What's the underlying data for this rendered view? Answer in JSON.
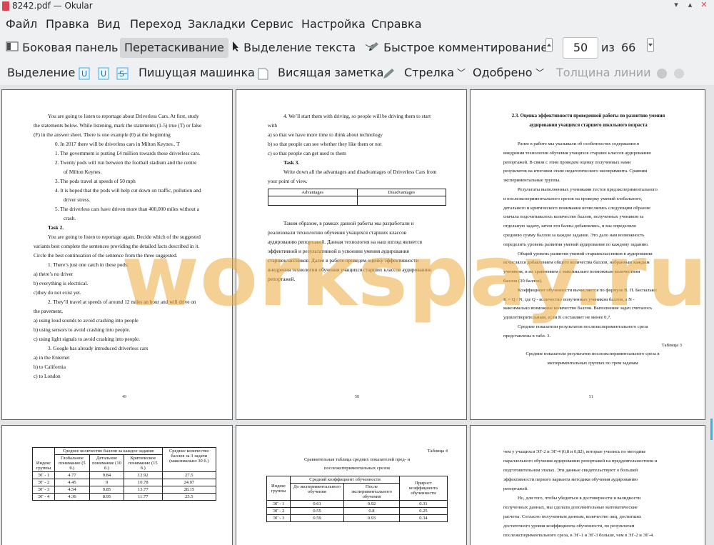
{
  "window": {
    "title": "8242.pdf  — Okular"
  },
  "menu": [
    "Файл",
    "Правка",
    "Вид",
    "Переход",
    "Закладки",
    "Сервис",
    "Настройка",
    "Справка"
  ],
  "toolbar1": {
    "sidebar": "Боковая панель",
    "drag": "Перетаскивание",
    "text_select": "Выделение текста",
    "quick_comment": "Быстрое комментирование",
    "page_current": "50",
    "page_of": "из",
    "page_total": "66"
  },
  "toolbar2": {
    "select": "Выделение",
    "typewriter": "Пишущая машинка",
    "hanging_note": "Висящая заметка",
    "arrow": "Стрелка",
    "approved": "Одобрено",
    "line_width": "Толщина линии"
  },
  "watermark": "workspay.ru",
  "pages": {
    "p49": {
      "lines": [
        "You are going to listen to reportage about Driverless Cars. At first, study",
        "the statements below. While listening, mark the statements (1-5) true (T) or false",
        "(F) in the answer sheet. There is one example (0) at the beginning",
        "0.  In 2017 there will be driverless cars in Milton Keynes.. T",
        "1.  The government is putting £4 million towards these driverless cars.",
        "2.  Twenty pods will run between the football stadium and the centre",
        "of Milton Keynes.",
        "3.  The pods travel at speeds of 50 mph",
        "4.  It is hoped that the pods will help cut down on traffic, pollution and",
        "driver stress.",
        "5.  The driverless cars have driven more than 400,000 miles without a",
        "crash.",
        "Task 2.",
        "You are going to listen to reportage again. Decide which of the suggested",
        "variants best complete the sentences providing the detailed facts described in it.",
        "Circle the best continuation of the sentence from the three suggested.",
        "1. There’s just one catch in these pods:",
        "a) there’s no driver",
        "b) everything is electrical.",
        "c)they do not exist yet.",
        "2. They’ll travel at speeds of around 12 miles an hour and will drive on",
        "the pavement,",
        "a) using loud sounds to avoid crashing into people",
        "b) using sensors to avoid crashing into people.",
        "c) using light signals to avoid crashing into people.",
        "3. Google has already introduced driverless cars",
        "a) in the Enternet",
        "b) to California",
        "c) to London"
      ],
      "num": "49"
    },
    "p50": {
      "lines": [
        "4. We’ll start them with driving, so people will be driving them to start",
        "with",
        "a) so that we have more time to think about technology",
        "b) so that people can see whether they like them or not",
        "c) so that people can get used to them",
        "Task 3.",
        "Write down all the advantages and disadvantages of Driverless Cars from",
        "your point of view."
      ],
      "table_headers": [
        "Advantages",
        "Disadvantages"
      ],
      "para": [
        "Таким образом, в рамках данной работы мы разработали и",
        "реализовали технологию обучения учащихся старших классов",
        "аудированию репортажей. Данная технология на наш взгляд является",
        "эффективной и результативной в усвоении умения аудирования",
        "старшеклассников. Далее в работе проведем оценку эффективности",
        "внедрения технологии обучения учащихся старших классов аудированию",
        "репортажей."
      ],
      "num": "50"
    },
    "p51": {
      "heading1": "2.3. Оценка эффективности проведенной работы по развитию умения",
      "heading2": "аудирования учащихся старшего школьного возраста",
      "lines": [
        "Ранее в работе мы указывали об особенностях содержания в",
        "внедрения технологии обучения учащихся старших классов аудированию",
        "репортажей. В связи с этим проведем оценку полученных нами",
        "результатов на итоговом этапе педагогического эксперимента. Сравним",
        "экспериментальные группы.",
        "Результаты выполненных учениками тестов предэкспериментального",
        "и послеэкспериментального срезов на проверку умений глобального,",
        "детального и критического понимания исчислялись следующим образом:",
        "сначала подсчитывалось количество баллов, полученных учеником за",
        "отдельную задачу, затем эти баллы добавлялись, и мы определяли",
        "среднюю сумму баллов за каждое задание. Это дало нам возможность",
        "определить уровень развития умений аудирования по каждому заданию.",
        "Общий уровень развития умений старшеклассников в аудировании",
        "исчислялся добавлением общего количества баллов, набранным каждым",
        "учеником, и их сравнением с максимально возможным количеством",
        "баллов (30 баллов).",
        "Коэффициент обученности вычисляется по формуле В. П. Беспалько:",
        "K = Q / N, где Q - количество полученных учеником баллов, а N -",
        "максимально возможное количество баллов. Выполнение задач считалось",
        "удовлетворительным, если К составляет не менее 0,7.",
        "Средние показатели результатов послеэкспериментального среза",
        "представлены в табл. 3."
      ],
      "table_label": "Таблица 3",
      "caption1": "Средние показатели результатов послеэкспериментального среза в",
      "caption2": "экспериментальных группах по трем задачам",
      "num": "51"
    },
    "p52": {
      "head_group": "Среднее количество баллов за каждое задание",
      "head_total": "Среднее количество баллов за 3 задачи (максимально 30 б.)",
      "head_index": "Индекс группы",
      "head_global": "Глобальное понимание (5 б.)",
      "head_detail": "Детальное понимание (10 б.)",
      "head_critical": "Критическое понимание (15 б.)",
      "rows": [
        [
          "ЭГ - 1",
          "4.77",
          "9.84",
          "12.92",
          "27.5"
        ],
        [
          "ЭГ - 2",
          "4.45",
          "9",
          "10.78",
          "24.07"
        ],
        [
          "ЭГ - 3",
          "4.54",
          "9.85",
          "13.77",
          "28.15"
        ],
        [
          "ЭГ - 4",
          "4.36",
          "8.95",
          "11.77",
          "25.5"
        ]
      ]
    },
    "p53": {
      "table_label": "Таблица 4",
      "caption1": "Сравнительная таблица средних показателей пред- и",
      "caption2": "послеэкспериментальных срезов",
      "head_coef": "Средний коэффициент обученности",
      "head_index": "Индекс группы",
      "head_before": "До экспериментального обучения",
      "head_after": "После экспериментального обучения",
      "head_gain": "Прирост коэффициента обученности",
      "rows": [
        [
          "ЭГ - 1",
          "0.61",
          "0.92",
          "0.31"
        ],
        [
          "ЭГ - 2",
          "0.55",
          "0.8",
          "0.25"
        ],
        [
          "ЭГ - 3",
          "0.59",
          "0.93",
          "0.34"
        ]
      ]
    },
    "p54": {
      "lines": [
        "чем у учащихся ЭГ-2 и ЭГ-4 (0,8 и 0,82), которые учились по методике",
        "параллельного обучения аудированию репортажей на преддеятельностном и",
        "подготовительном этапах. Эти данные свидетельствуют о большей",
        "эффективности первого варианта методики обучения аудированию",
        "репортажей.",
        "Но, для того, чтобы убедиться в достоверности и валидности",
        "полученных данных, мы сделали дополнительные математические",
        "расчеты. Согласно полученным данным, количество лиц, достигших",
        "достаточного уровня коэффициента обученности, по результатам",
        "послеэкспериментального среза, в ЭГ-1 и ЭГ-3 больше, чем в ЭГ-2 и ЭГ-4."
      ]
    }
  }
}
